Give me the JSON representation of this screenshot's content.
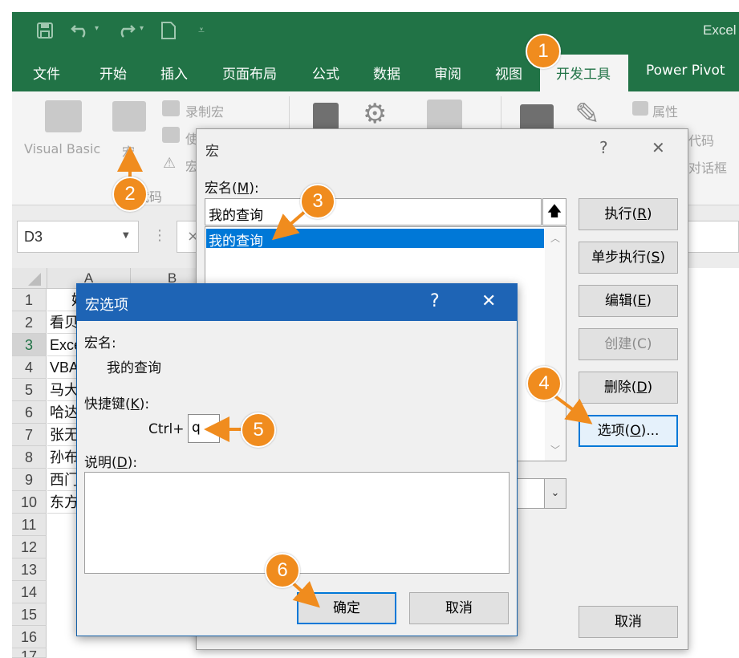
{
  "app_title": "Excel",
  "ribbon_tabs": [
    "文件",
    "开始",
    "插入",
    "页面布局",
    "公式",
    "数据",
    "审阅",
    "视图",
    "开发工具",
    "Power Pivot"
  ],
  "ribbon": {
    "visual_basic": "Visual Basic",
    "macros": "宏",
    "record_macro": "录制宏",
    "use_relative": "使",
    "macro_security": "宏",
    "group_code": "代码",
    "properties": "属性",
    "view_code": "代码",
    "run_dialog": "对话框"
  },
  "name_box": "D3",
  "formula_bar_cancel": "×",
  "columns": [
    "A",
    "B"
  ],
  "rows": [
    "1",
    "2",
    "3",
    "4",
    "5",
    "6",
    "7",
    "8",
    "9",
    "10",
    "11",
    "12",
    "13",
    "14",
    "15",
    "16",
    "17"
  ],
  "cells_a": [
    "姓",
    "看贝",
    "Exce",
    "VBA",
    "马大",
    "哈达",
    "张无",
    "孙布",
    "西门",
    "东方"
  ],
  "macro_dialog": {
    "title": "宏",
    "help": "?",
    "close": "✕",
    "macro_name_label": "宏名(",
    "macro_name_key": "M",
    "macro_name_label_end": "):",
    "macro_name_value": "我的查询",
    "list_items": [
      "我的查询"
    ],
    "buttons": {
      "run": "执行(",
      "run_key": "R",
      "step": "单步执行(",
      "step_key": "S",
      "edit": "编辑(",
      "edit_key": "E",
      "create": "创建(C)",
      "delete": "删除(",
      "delete_key": "D",
      "options": "选项(",
      "options_key": "O",
      "options_end": ")...",
      "cancel": "取消"
    }
  },
  "options_dialog": {
    "title": "宏选项",
    "help": "?",
    "close": "✕",
    "macro_name_label": "宏名:",
    "macro_name_value": "我的查询",
    "shortcut_label": "快捷键(",
    "shortcut_key": "K",
    "shortcut_label_end": "):",
    "ctrl_prefix": "Ctrl+",
    "shortcut_value": "q",
    "description_label": "说明(",
    "description_key": "D",
    "description_label_end": "):",
    "ok": "确定",
    "cancel": "取消"
  },
  "annotations": [
    "1",
    "2",
    "3",
    "4",
    "5",
    "6"
  ],
  "colors": {
    "excel_green": "#217346",
    "accent_blue": "#0078d7",
    "annotation_orange": "#f08c1e"
  },
  "icons": [
    "save-icon",
    "undo-icon",
    "redo-icon",
    "new-doc-icon",
    "customize-qat-icon",
    "up-arrow-icon",
    "dropdown-arrow-icon"
  ]
}
